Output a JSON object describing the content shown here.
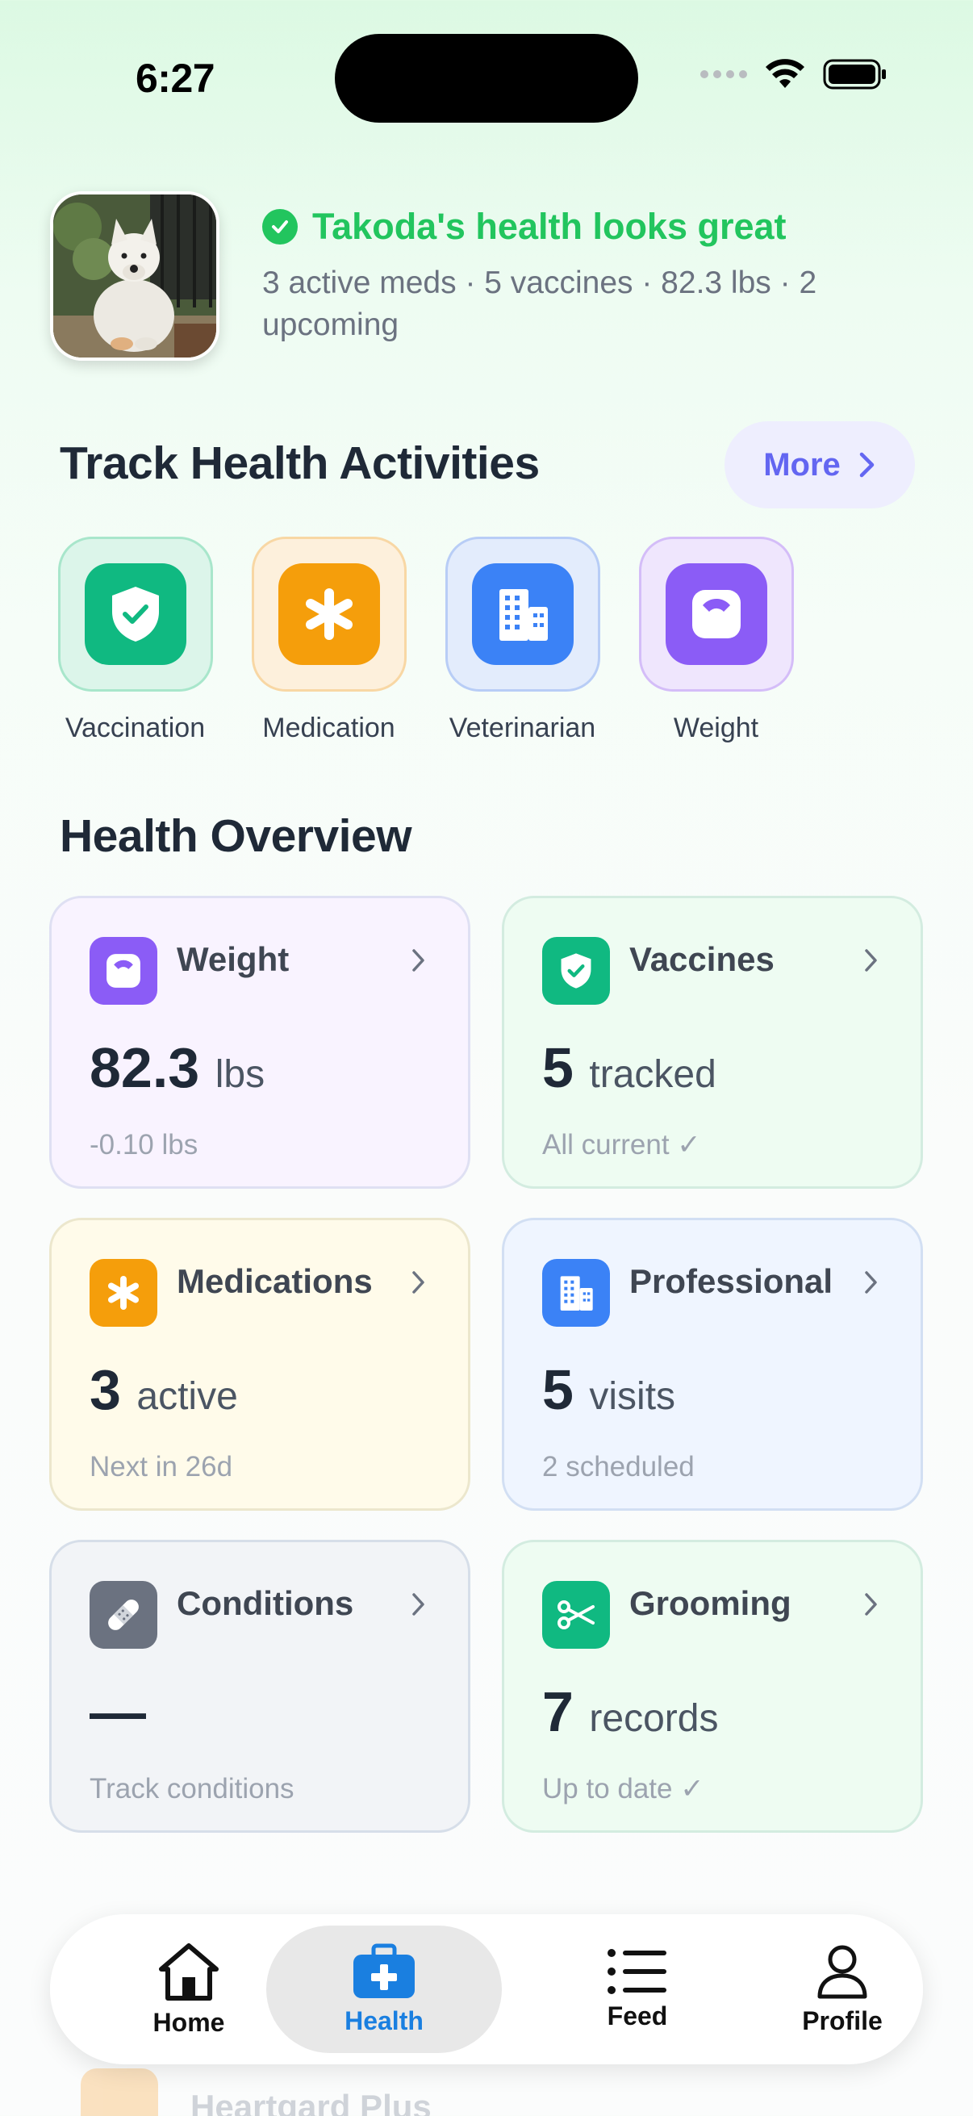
{
  "status_bar": {
    "time": "6:27"
  },
  "header": {
    "pet_name_status": "Takoda's health looks great",
    "summary": "3 active meds · 5 vaccines · 82.3 lbs · 2 upcoming"
  },
  "track": {
    "title": "Track Health Activities",
    "more_label": "More",
    "activities": [
      {
        "label": "Vaccination",
        "icon": "shield-check-icon",
        "color": "#10b981"
      },
      {
        "label": "Medication",
        "icon": "asterisk-icon",
        "color": "#f59e0b"
      },
      {
        "label": "Veterinarian",
        "icon": "building-icon",
        "color": "#3b82f6"
      },
      {
        "label": "Weight",
        "icon": "scale-icon",
        "color": "#8b5cf6"
      }
    ]
  },
  "overview": {
    "title": "Health Overview",
    "cards": [
      {
        "title": "Weight",
        "value": "82.3",
        "unit": "lbs",
        "sub": "-0.10 lbs",
        "icon": "scale-icon",
        "color": "#8b5cf6"
      },
      {
        "title": "Vaccines",
        "value": "5",
        "unit": "tracked",
        "sub": "All current ✓",
        "icon": "shield-check-icon",
        "color": "#10b981"
      },
      {
        "title": "Medications",
        "value": "3",
        "unit": "active",
        "sub": "Next in 26d",
        "icon": "asterisk-icon",
        "color": "#f59e0b"
      },
      {
        "title": "Professional",
        "value": "5",
        "unit": "visits",
        "sub": "2 scheduled",
        "icon": "building-icon",
        "color": "#3b82f6"
      },
      {
        "title": "Conditions",
        "value": "—",
        "unit": "",
        "sub": "Track conditions",
        "icon": "bandage-icon",
        "color": "#6b7280"
      },
      {
        "title": "Grooming",
        "value": "7",
        "unit": "records",
        "sub": "Up to date ✓",
        "icon": "scissors-icon",
        "color": "#10b981"
      }
    ]
  },
  "behind_nav": {
    "item": "Heartgard Plus"
  },
  "tabbar": {
    "tabs": [
      {
        "label": "Home",
        "icon": "home-icon"
      },
      {
        "label": "Health",
        "icon": "medical-kit-icon",
        "active": true
      },
      {
        "label": "Feed",
        "icon": "list-icon"
      },
      {
        "label": "Profile",
        "icon": "person-icon"
      }
    ]
  }
}
